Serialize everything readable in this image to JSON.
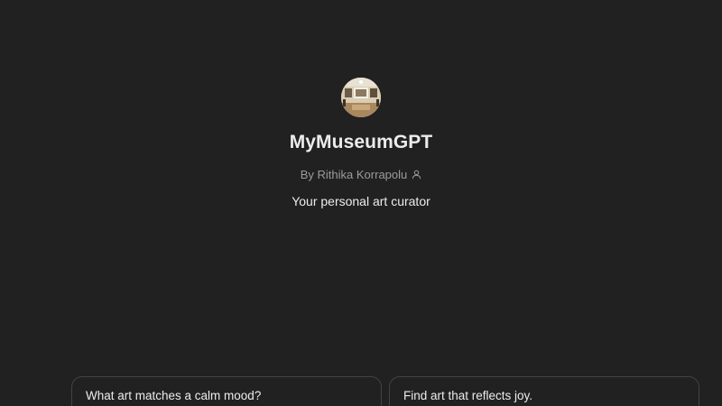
{
  "gpt": {
    "name": "MyMuseumGPT",
    "author": "By Rithika Korrapolu",
    "description": "Your personal art curator",
    "avatar_icon": "museum-gallery-image",
    "author_icon": "user-icon"
  },
  "conversation_starters": [
    {
      "label": "What art matches a calm mood?"
    },
    {
      "label": "Find art that reflects joy."
    }
  ],
  "colors": {
    "background": "#212121",
    "text_primary": "#ececec",
    "text_secondary": "#9b9b9b",
    "card_border": "#434343"
  }
}
